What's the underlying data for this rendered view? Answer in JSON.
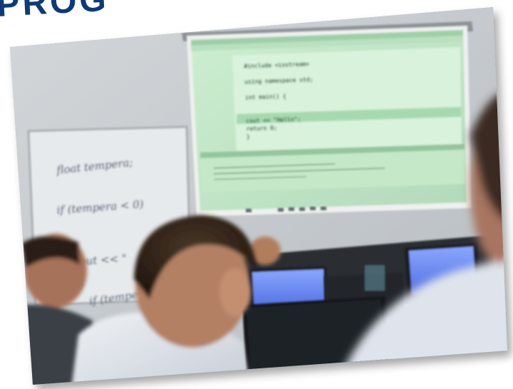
{
  "heading": {
    "text": "PROG"
  },
  "projected_screen": {
    "code_lines": [
      "#include <iostream>",
      "",
      "using namespace std;",
      "",
      "int main() {",
      "",
      "",
      "    cout << \"Hello\";",
      "    return 0;",
      "}"
    ]
  },
  "whiteboard": {
    "lines": [
      "float  tempera;",
      "if (tempera < 0)",
      "",
      "out << \"",
      "}",
      "if (tempe"
    ]
  },
  "colors": {
    "heading": "#0e3a78",
    "wall": "#c9ced2",
    "projection": "#c6e6c9",
    "code_highlight": "#a7d9b0",
    "monitor_glow": "#6f8ff0",
    "shirt": "#dfe4ec",
    "hair": "#3a2c22"
  }
}
